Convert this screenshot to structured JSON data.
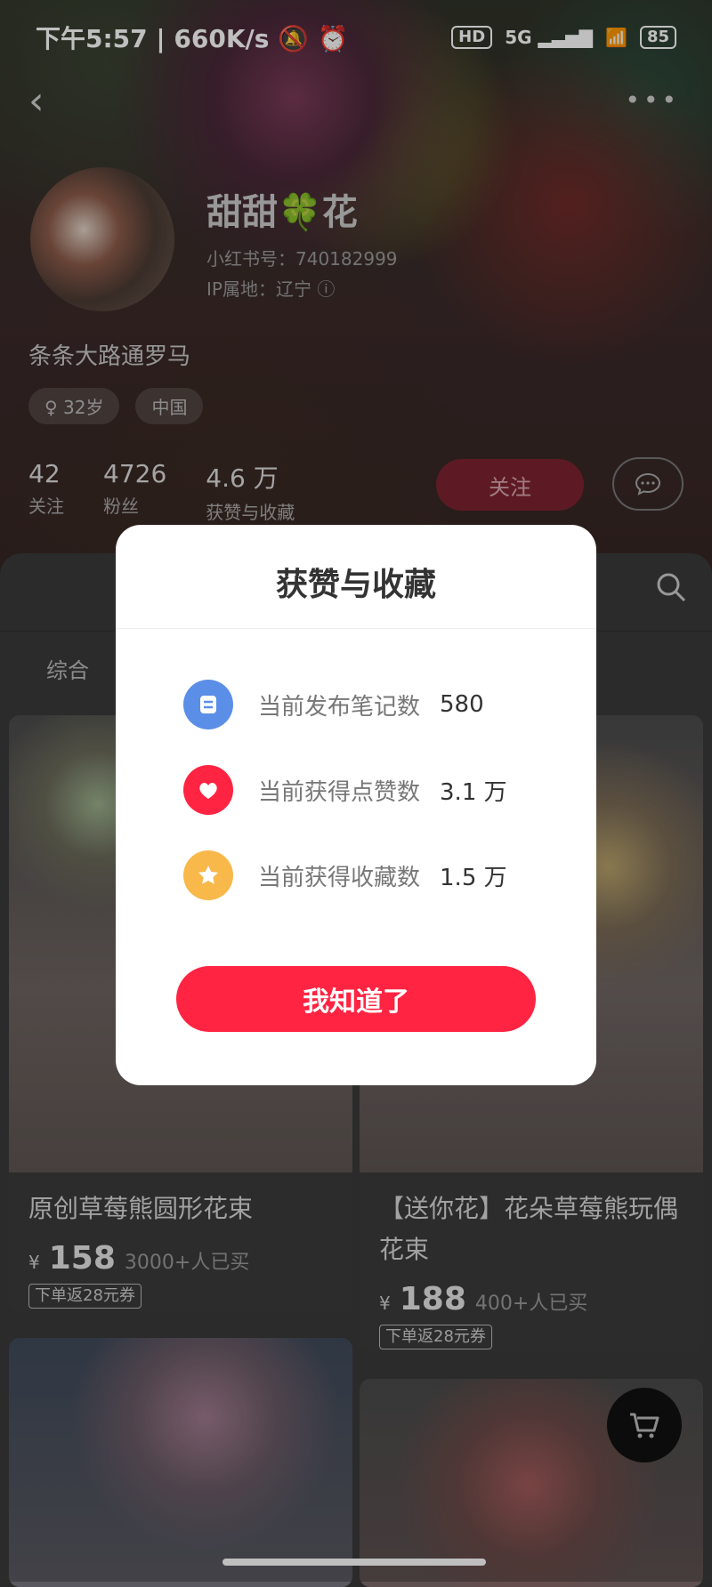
{
  "status_bar": {
    "time": "下午5:57",
    "speed": "660K/s",
    "hd": "HD",
    "network": "5G",
    "battery": "85"
  },
  "profile": {
    "name": "甜甜🍀花",
    "id_line": "小红书号：740182999",
    "ip_line": "IP属地：辽宁",
    "signature": "条条大路通罗马",
    "tags": [
      "♀ 32岁",
      "中国"
    ],
    "stats": [
      {
        "value": "42",
        "label": "关注"
      },
      {
        "value": "4726",
        "label": "粉丝"
      },
      {
        "value": "4.6 万",
        "label": "获赞与收藏"
      }
    ],
    "follow_label": "关注"
  },
  "content": {
    "tab_label": "综合",
    "products": [
      {
        "title": "原创草莓熊圆形花束",
        "price_symbol": "¥",
        "price": "158",
        "sold": "3000+人已买",
        "coupon": "下单返28元券"
      },
      {
        "title": "【送你花】花朵草莓熊玩偶花束",
        "price_symbol": "¥",
        "price": "188",
        "sold": "400+人已买",
        "coupon": "下单返28元券"
      }
    ]
  },
  "modal": {
    "title": "获赞与收藏",
    "rows": [
      {
        "label": "当前发布笔记数",
        "value": "580",
        "icon": "notes-icon",
        "color": "#5b8ee6"
      },
      {
        "label": "当前获得点赞数",
        "value": "3.1 万",
        "icon": "heart-icon",
        "color": "#ff2442"
      },
      {
        "label": "当前获得收藏数",
        "value": "1.5 万",
        "icon": "star-icon",
        "color": "#f8b84a"
      }
    ],
    "button_label": "我知道了"
  },
  "colors": {
    "accent": "#ff2442",
    "follow_button": "#7e2330"
  }
}
